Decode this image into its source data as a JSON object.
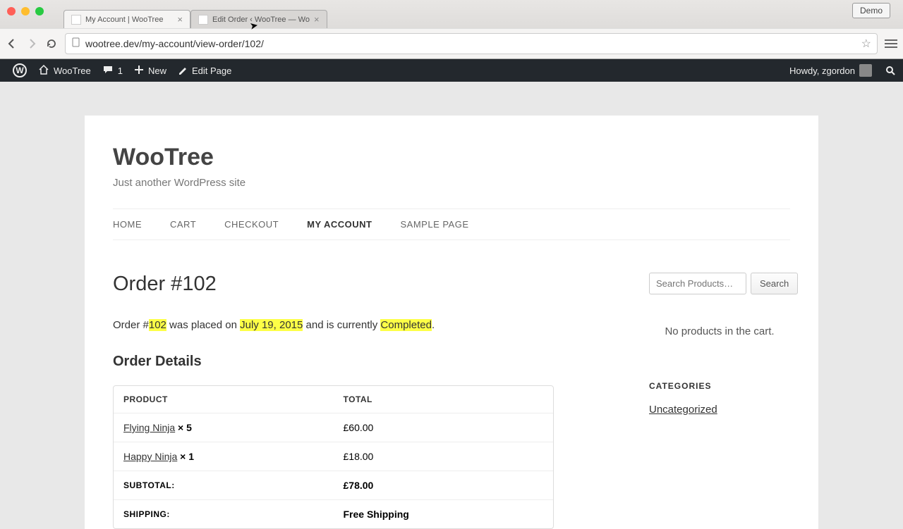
{
  "browser": {
    "tabs": [
      {
        "title": "My Account | WooTree",
        "active": true
      },
      {
        "title": "Edit Order ‹ WooTree — Wo",
        "active": false
      }
    ],
    "url": "wootree.dev/my-account/view-order/102/",
    "demo_label": "Demo"
  },
  "adminbar": {
    "site_name": "WooTree",
    "comments": "1",
    "new_label": "New",
    "edit_label": "Edit Page",
    "howdy": "Howdy, zgordon"
  },
  "site": {
    "title": "WooTree",
    "tagline": "Just another WordPress site"
  },
  "nav": {
    "home": "HOME",
    "cart": "CART",
    "checkout": "CHECKOUT",
    "account": "MY ACCOUNT",
    "sample": "SAMPLE PAGE"
  },
  "order": {
    "heading": "Order #102",
    "summary_pre": "Order #",
    "number": "102",
    "summary_mid1": " was placed on ",
    "date": "July 19, 2015",
    "summary_mid2": " and is currently ",
    "status": "Completed",
    "summary_end": ".",
    "details_heading": "Order Details",
    "th_product": "PRODUCT",
    "th_total": "TOTAL",
    "items": [
      {
        "name": "Flying Ninja",
        "qty": "× 5",
        "total": "£60.00"
      },
      {
        "name": "Happy Ninja",
        "qty": "× 1",
        "total": "£18.00"
      }
    ],
    "subtotal_label": "SUBTOTAL:",
    "subtotal": "£78.00",
    "shipping_label": "SHIPPING:",
    "shipping": "Free Shipping"
  },
  "sidebar": {
    "search_placeholder": "Search Products…",
    "search_btn": "Search",
    "cart_empty": "No products in the cart.",
    "categories_heading": "CATEGORIES",
    "category": "Uncategorized"
  }
}
